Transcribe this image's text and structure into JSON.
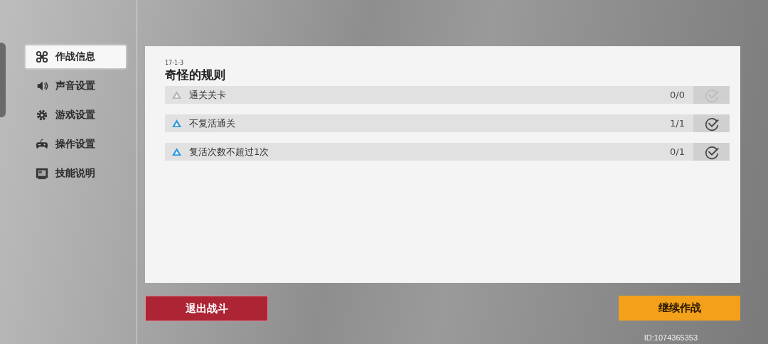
{
  "sidebar": {
    "items": [
      {
        "label": "作战信息",
        "kind": "drone",
        "selected": true
      },
      {
        "label": "声音设置",
        "kind": "speaker",
        "selected": false
      },
      {
        "label": "游戏设置",
        "kind": "gear",
        "selected": false
      },
      {
        "label": "操作设置",
        "kind": "gamepad",
        "selected": false
      },
      {
        "label": "技能说明",
        "kind": "screen",
        "selected": false
      }
    ]
  },
  "mission": {
    "code": "17-1-3",
    "title": "奇怪的规则",
    "objectives": [
      {
        "label": "通关关卡",
        "progress": "0/0",
        "enabled": false
      },
      {
        "label": "不复活通关",
        "progress": "1/1",
        "enabled": true
      },
      {
        "label": "复活次数不超过1次",
        "progress": "0/1",
        "enabled": true
      }
    ]
  },
  "buttons": [
    {
      "label": "退出战斗",
      "kind": "exit"
    },
    {
      "label": "继续作战",
      "kind": "continue"
    }
  ],
  "player_id": "ID:1074365353"
}
